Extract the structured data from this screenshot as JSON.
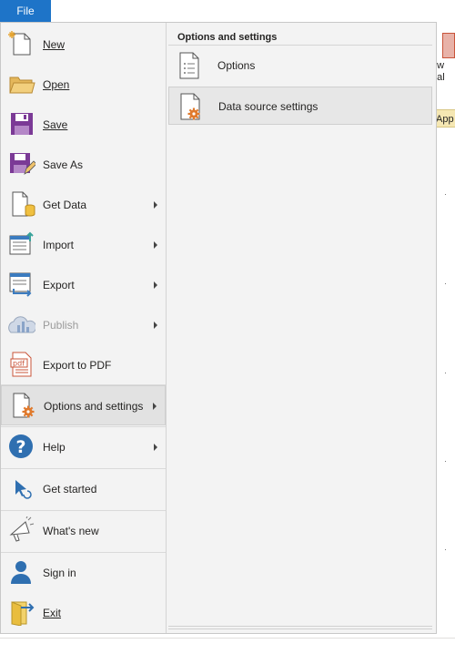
{
  "file_tab": {
    "label": "File"
  },
  "background": {
    "ribbon_text_1": "ew",
    "ribbon_text_2": "ual",
    "app_tab": "App"
  },
  "menu": {
    "items": [
      {
        "id": "new",
        "label": "New",
        "has_submenu": false,
        "disabled": false
      },
      {
        "id": "open",
        "label": "Open",
        "has_submenu": false,
        "disabled": false
      },
      {
        "id": "save",
        "label": "Save",
        "has_submenu": false,
        "disabled": false
      },
      {
        "id": "save_as",
        "label": "Save As",
        "has_submenu": false,
        "disabled": false
      },
      {
        "id": "get_data",
        "label": "Get Data",
        "has_submenu": true,
        "disabled": false
      },
      {
        "id": "import",
        "label": "Import",
        "has_submenu": true,
        "disabled": false
      },
      {
        "id": "export",
        "label": "Export",
        "has_submenu": true,
        "disabled": false
      },
      {
        "id": "publish",
        "label": "Publish",
        "has_submenu": true,
        "disabled": true
      },
      {
        "id": "export_pdf",
        "label": "Export to PDF",
        "has_submenu": false,
        "disabled": false
      },
      {
        "id": "options_settings",
        "label": "Options and settings",
        "has_submenu": true,
        "disabled": false,
        "selected": true
      },
      {
        "id": "help",
        "label": "Help",
        "has_submenu": true,
        "disabled": false
      },
      {
        "id": "get_started",
        "label": "Get started",
        "has_submenu": false,
        "disabled": false
      },
      {
        "id": "whats_new",
        "label": "What's new",
        "has_submenu": false,
        "disabled": false
      },
      {
        "id": "sign_in",
        "label": "Sign in",
        "has_submenu": false,
        "disabled": false
      },
      {
        "id": "exit",
        "label": "Exit",
        "has_submenu": false,
        "disabled": false
      }
    ]
  },
  "submenu": {
    "title": "Options and settings",
    "items": [
      {
        "id": "options",
        "label": "Options",
        "icon": "options-document-icon"
      },
      {
        "id": "data_source_settings",
        "label": "Data source settings",
        "icon": "data-source-settings-icon",
        "highlighted": true
      }
    ]
  },
  "colors": {
    "file_tab": "#1e74c8",
    "panel_bg": "#f3f3f3",
    "selected_bg": "#e2e2e2",
    "accent_orange": "#e07a2d",
    "save_purple": "#7b3a96"
  }
}
